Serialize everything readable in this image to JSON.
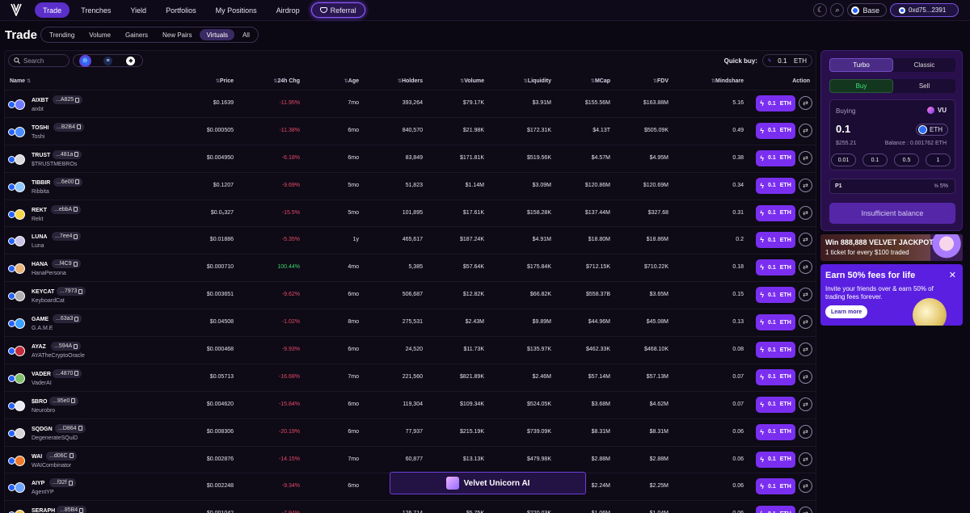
{
  "nav": {
    "items": [
      {
        "label": "Trade",
        "active": true
      },
      {
        "label": "Trenches"
      },
      {
        "label": "Yield"
      },
      {
        "label": "Portfolios"
      },
      {
        "label": "My Positions"
      },
      {
        "label": "Airdrop"
      }
    ],
    "referral_label": "Referral",
    "chain_label": "Base",
    "wallet_label": "0xd75...2391"
  },
  "page": {
    "title": "Trade",
    "tabs": [
      "Trending",
      "Volume",
      "Gainers",
      "New Pairs",
      "Virtuals",
      "All"
    ],
    "active_tab": "Virtuals"
  },
  "toolbar": {
    "search_placeholder": "Search",
    "quick_buy_label": "Quick buy:",
    "quick_buy_value": "0.1",
    "quick_buy_unit": "ETH"
  },
  "table": {
    "columns": [
      "Name",
      "Price",
      "24h Chg",
      "Age",
      "Holders",
      "Volume",
      "Liquidity",
      "MCap",
      "FDV",
      "Mindshare",
      "Action"
    ],
    "buy_amount": "0.1",
    "buy_unit": "ETH",
    "rows": [
      {
        "symbol": "AIXBT",
        "addr": "...A825",
        "name": "aixbt",
        "price": "$0.1639",
        "chg": "-11.95%",
        "age": "7mo",
        "holders": "393,264",
        "volume": "$79.17K",
        "liquidity": "$3.91M",
        "mcap": "$155.56M",
        "fdv": "$163.88M",
        "mindshare": "5.16",
        "color": "#6f7bff"
      },
      {
        "symbol": "TOSHI",
        "addr": "...B2B4",
        "name": "Toshi",
        "price": "$0.000505",
        "chg": "-11.38%",
        "age": "6mo",
        "holders": "840,570",
        "volume": "$21.98K",
        "liquidity": "$172.31K",
        "mcap": "$4.13T",
        "fdv": "$505.09K",
        "mindshare": "0.49",
        "color": "#4a8cff"
      },
      {
        "symbol": "TRUST",
        "addr": "...481a",
        "name": "$TRUSTMEBROs",
        "price": "$0.004950",
        "chg": "-6.18%",
        "age": "6mo",
        "holders": "83,849",
        "volume": "$171.81K",
        "liquidity": "$519.56K",
        "mcap": "$4.57M",
        "fdv": "$4.95M",
        "mindshare": "0.38",
        "color": "#d8d8d8"
      },
      {
        "symbol": "TIBBIR",
        "addr": "...6e00",
        "name": "Ribbita",
        "price": "$0.1207",
        "chg": "-9.69%",
        "age": "5mo",
        "holders": "51,823",
        "volume": "$1.14M",
        "liquidity": "$3.09M",
        "mcap": "$120.86M",
        "fdv": "$120.69M",
        "mindshare": "0.34",
        "color": "#8fc7ff"
      },
      {
        "symbol": "REKT",
        "addr": "...ebbA",
        "name": "Rekt",
        "price": "$0.0₅327",
        "chg": "-15.5%",
        "age": "5mo",
        "holders": "101,895",
        "volume": "$17.61K",
        "liquidity": "$158.28K",
        "mcap": "$137.44M",
        "fdv": "$327.68",
        "mindshare": "0.31",
        "color": "#f5d64a"
      },
      {
        "symbol": "LUNA",
        "addr": "...7ee4",
        "name": "Luna",
        "price": "$0.01886",
        "chg": "-5.35%",
        "age": "1y",
        "holders": "465,617",
        "volume": "$187.24K",
        "liquidity": "$4.91M",
        "mcap": "$18.80M",
        "fdv": "$18.86M",
        "mindshare": "0.2",
        "color": "#c9c4e6"
      },
      {
        "symbol": "HANA",
        "addr": "...f4C9",
        "name": "HanaPersona",
        "price": "$0.000710",
        "chg": "100.44%",
        "age": "4mo",
        "holders": "5,385",
        "volume": "$57.64K",
        "liquidity": "$175.84K",
        "mcap": "$712.15K",
        "fdv": "$710.22K",
        "mindshare": "0.18",
        "color": "#e8b27a"
      },
      {
        "symbol": "KEYCAT",
        "addr": "...7973",
        "name": "KeyboardCat",
        "price": "$0.003651",
        "chg": "-9.62%",
        "age": "6mo",
        "holders": "506,687",
        "volume": "$12.82K",
        "liquidity": "$66.82K",
        "mcap": "$558.37B",
        "fdv": "$3.65M",
        "mindshare": "0.15",
        "color": "#b0b0b0"
      },
      {
        "symbol": "GAME",
        "addr": "...63a3",
        "name": "G.A.M.E",
        "price": "$0.04508",
        "chg": "-1.02%",
        "age": "8mo",
        "holders": "275,531",
        "volume": "$2.43M",
        "liquidity": "$9.89M",
        "mcap": "$44.96M",
        "fdv": "$45.08M",
        "mindshare": "0.13",
        "color": "#3aa0ff"
      },
      {
        "symbol": "AYAZ",
        "addr": "...594A",
        "name": "AYATheCryptoOracle",
        "price": "$0.000468",
        "chg": "-9.93%",
        "age": "6mo",
        "holders": "24,520",
        "volume": "$11.73K",
        "liquidity": "$135.97K",
        "mcap": "$462.33K",
        "fdv": "$468.10K",
        "mindshare": "0.08",
        "color": "#c42b3a"
      },
      {
        "symbol": "VADER",
        "addr": "...4870",
        "name": "VaderAI",
        "price": "$0.05713",
        "chg": "-16.68%",
        "age": "7mo",
        "holders": "221,560",
        "volume": "$821.89K",
        "liquidity": "$2.46M",
        "mcap": "$57.14M",
        "fdv": "$57.13M",
        "mindshare": "0.07",
        "color": "#7fbf6a"
      },
      {
        "symbol": "$BRO",
        "addr": "...95e0",
        "name": "Neurobro",
        "price": "$0.004620",
        "chg": "-15.84%",
        "age": "6mo",
        "holders": "119,304",
        "volume": "$109.34K",
        "liquidity": "$524.05K",
        "mcap": "$3.68M",
        "fdv": "$4.62M",
        "mindshare": "0.07",
        "color": "#e8e8f0"
      },
      {
        "symbol": "SQDGN",
        "addr": "...D864",
        "name": "DegenerateSQuiD",
        "price": "$0.008306",
        "chg": "-20.19%",
        "age": "6mo",
        "holders": "77,937",
        "volume": "$215.19K",
        "liquidity": "$739.09K",
        "mcap": "$8.31M",
        "fdv": "$8.31M",
        "mindshare": "0.06",
        "color": "#d6d6d6"
      },
      {
        "symbol": "WAI",
        "addr": "...d06C",
        "name": "WAICombinator",
        "price": "$0.002876",
        "chg": "-14.15%",
        "age": "7mo",
        "holders": "60,877",
        "volume": "$13.13K",
        "liquidity": "$479.98K",
        "mcap": "$2.88M",
        "fdv": "$2.88M",
        "mindshare": "0.06",
        "color": "#f07a2a"
      },
      {
        "symbol": "AIYP",
        "addr": "...f32f",
        "name": "AgentYP",
        "price": "$0.002248",
        "chg": "-9.34%",
        "age": "6mo",
        "holders": "",
        "volume": "",
        "liquidity": "",
        "mcap": "$2.24M",
        "fdv": "$2.25M",
        "mindshare": "0.06",
        "color": "#6fa3ff"
      },
      {
        "symbol": "SERAPH",
        "addr": "...85B4",
        "name": "",
        "price": "$0.001042",
        "chg": "-7.94%",
        "age": "",
        "holders": "126,714",
        "volume": "$5.75K",
        "liquidity": "$220.03K",
        "mcap": "$1.06M",
        "fdv": "$1.04M",
        "mindshare": "0.06",
        "color": "#f2c14e"
      }
    ]
  },
  "floating_banner": {
    "label": "Velvet Unicorn AI"
  },
  "trade_panel": {
    "modes": [
      "Turbo",
      "Classic"
    ],
    "sides": [
      "Buy",
      "Sell"
    ],
    "buying_label": "Buying",
    "token": "VU",
    "amount": "0.1",
    "amount_unit": "ETH",
    "usd_value": "$255.21",
    "balance_label": "Balance :",
    "balance_value": "0.001762",
    "balance_unit": "ETH",
    "presets": [
      "0.01",
      "0.1",
      "0.5",
      "1"
    ],
    "slippage_preset": "P1",
    "slippage_value": "5%",
    "submit_label": "Insufficient balance"
  },
  "jackpot": {
    "title": "Win 888,888 VELVET JACKPOT",
    "subtitle": "1 ticket for every $100 traded"
  },
  "earn_card": {
    "title": "Earn 50% fees for life",
    "text": "Invite your friends over & earn 50% of trading fees forever.",
    "button": "Learn more"
  },
  "colors": {
    "accent": "#7a2ff0",
    "negative": "#e64b6a",
    "positive": "#3ad46b",
    "panel": "#29104d"
  }
}
